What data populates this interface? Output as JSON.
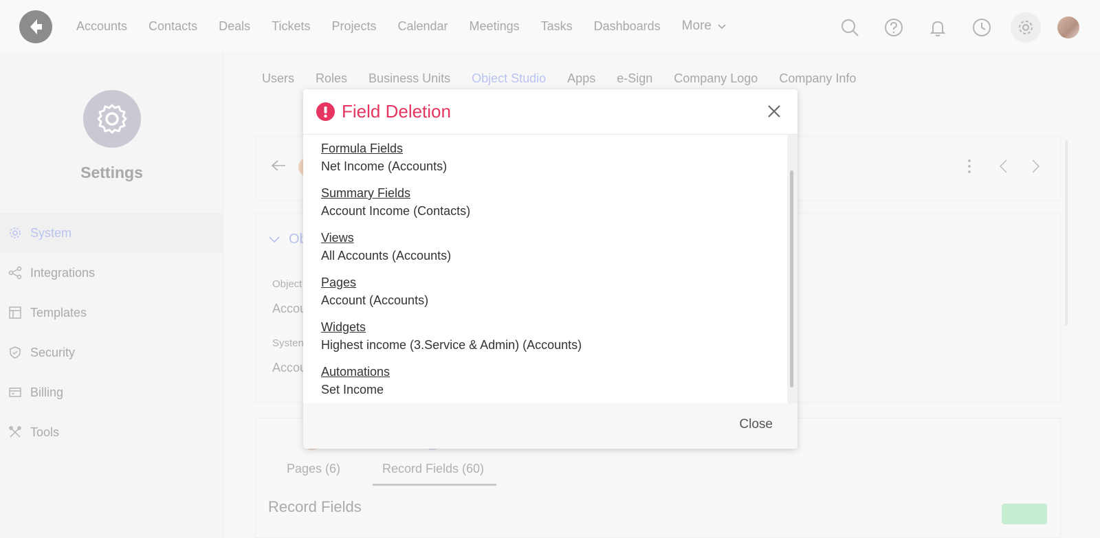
{
  "topnav": {
    "items": [
      "Accounts",
      "Contacts",
      "Deals",
      "Tickets",
      "Projects",
      "Calendar",
      "Meetings",
      "Tasks",
      "Dashboards"
    ],
    "more_label": "More"
  },
  "sidebar": {
    "title": "Settings",
    "items": [
      {
        "label": "System",
        "icon": "gear-icon",
        "active": true
      },
      {
        "label": "Integrations",
        "icon": "share-icon",
        "active": false
      },
      {
        "label": "Templates",
        "icon": "layout-icon",
        "active": false
      },
      {
        "label": "Security",
        "icon": "shield-icon",
        "active": false
      },
      {
        "label": "Billing",
        "icon": "credit-card-icon",
        "active": false
      },
      {
        "label": "Tools",
        "icon": "tools-icon",
        "active": false
      }
    ]
  },
  "settings_tabs": [
    "Users",
    "Roles",
    "Business Units",
    "Object Studio",
    "Apps",
    "e-Sign",
    "Company Logo",
    "Company Info"
  ],
  "background": {
    "section_prefix": "Ob",
    "object_label": "Object",
    "object_value": "Accou",
    "system_label": "Systen",
    "system_value": "Accou",
    "tab_pages": "Pages (6)",
    "tab_record_fields": "Record Fields (60)",
    "record_fields_heading": "Record Fields"
  },
  "modal": {
    "title": "Field Deletion",
    "groups": [
      {
        "heading": "Formula Fields",
        "value": "Net Income (Accounts)"
      },
      {
        "heading": "Summary Fields",
        "value": "Account Income (Contacts)"
      },
      {
        "heading": "Views",
        "value": "All Accounts (Accounts)"
      },
      {
        "heading": "Pages",
        "value": "Account (Accounts)"
      },
      {
        "heading": "Widgets",
        "value": "Highest income (3.Service & Admin) (Accounts)"
      },
      {
        "heading": "Automations",
        "value": "Set Income"
      }
    ],
    "close_label": "Close"
  },
  "colors": {
    "danger": "#e53560",
    "accent_muted": "#b9c3f0"
  }
}
